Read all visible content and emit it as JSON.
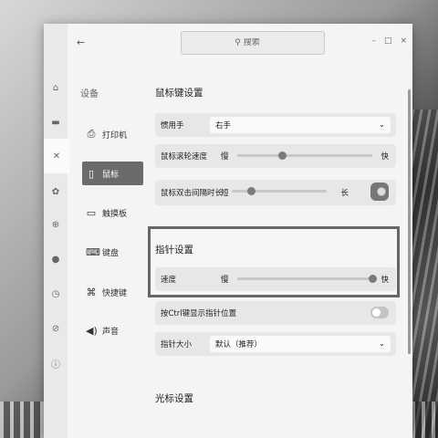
{
  "search": {
    "placeholder": "搜索"
  },
  "window_controls": [
    "–",
    "□",
    "×"
  ],
  "category": {
    "title": "设备",
    "items": [
      {
        "label": "打印机",
        "icon": "printer-icon"
      },
      {
        "label": "鼠标",
        "icon": "mouse-icon",
        "active": true
      },
      {
        "label": "触摸板",
        "icon": "touchpad-icon"
      },
      {
        "label": "键盘",
        "icon": "keyboard-icon"
      },
      {
        "label": "快捷键",
        "icon": "shortcut-icon"
      },
      {
        "label": "声音",
        "icon": "sound-icon"
      }
    ]
  },
  "mouse_keys": {
    "title": "鼠标键设置",
    "handedness_label": "惯用手",
    "handedness_value": "右手",
    "scroll_speed_label": "鼠标滚轮速度",
    "scroll_speed_min": "慢",
    "scroll_speed_max": "快",
    "scroll_speed_value": 0.33,
    "double_click_label": "鼠标双击间隔时长",
    "double_click_min": "短",
    "double_click_max": "长",
    "double_click_value": 0.2
  },
  "pointer": {
    "title": "指针设置",
    "speed_label": "速度",
    "speed_min": "慢",
    "speed_max": "快",
    "speed_value": 1.0,
    "ctrl_show_label": "按Ctrl键显示指针位置",
    "ctrl_show_on": false,
    "size_label": "指针大小",
    "size_value": "默认（推荐）"
  },
  "cursor": {
    "title": "光标设置"
  }
}
